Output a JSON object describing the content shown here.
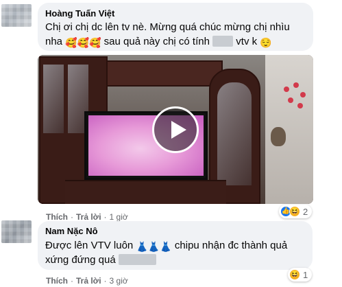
{
  "comments": [
    {
      "author": "Hoàng Tuấn Việt",
      "line1": "Chị ơi chị dc lên tv nè. Mừng quá chúc mừng chị nhìu",
      "line2_start": "nha",
      "line2_emojis": "🥰🥰🥰",
      "line2_mid": " sau quả này chị có tính",
      "line2_end": "vtv k",
      "line2_end_emoji": "😌",
      "reactions": {
        "icons": [
          "like-icon",
          "haha-icon"
        ],
        "count": "2"
      },
      "actions": {
        "like": "Thích",
        "reply": "Trả lời",
        "time": "1 giờ"
      }
    },
    {
      "author": "Nam Nặc Nô",
      "line1_start": "Được lên VTV luôn",
      "line1_emojis": "👗👗👗",
      "line1_end": "chipu nhận đc thành quả",
      "line2": "xứng đứng quá",
      "reactions": {
        "icons": [
          "haha-icon"
        ],
        "count": "1"
      },
      "actions": {
        "like": "Thích",
        "reply": "Trả lời",
        "time": "3 giờ"
      }
    }
  ],
  "video": {
    "icon": "play-icon"
  },
  "colors": {
    "bubble": "#f0f2f5",
    "meta": "#65676b",
    "like": "#1877f2",
    "haha": "#f7b125"
  }
}
